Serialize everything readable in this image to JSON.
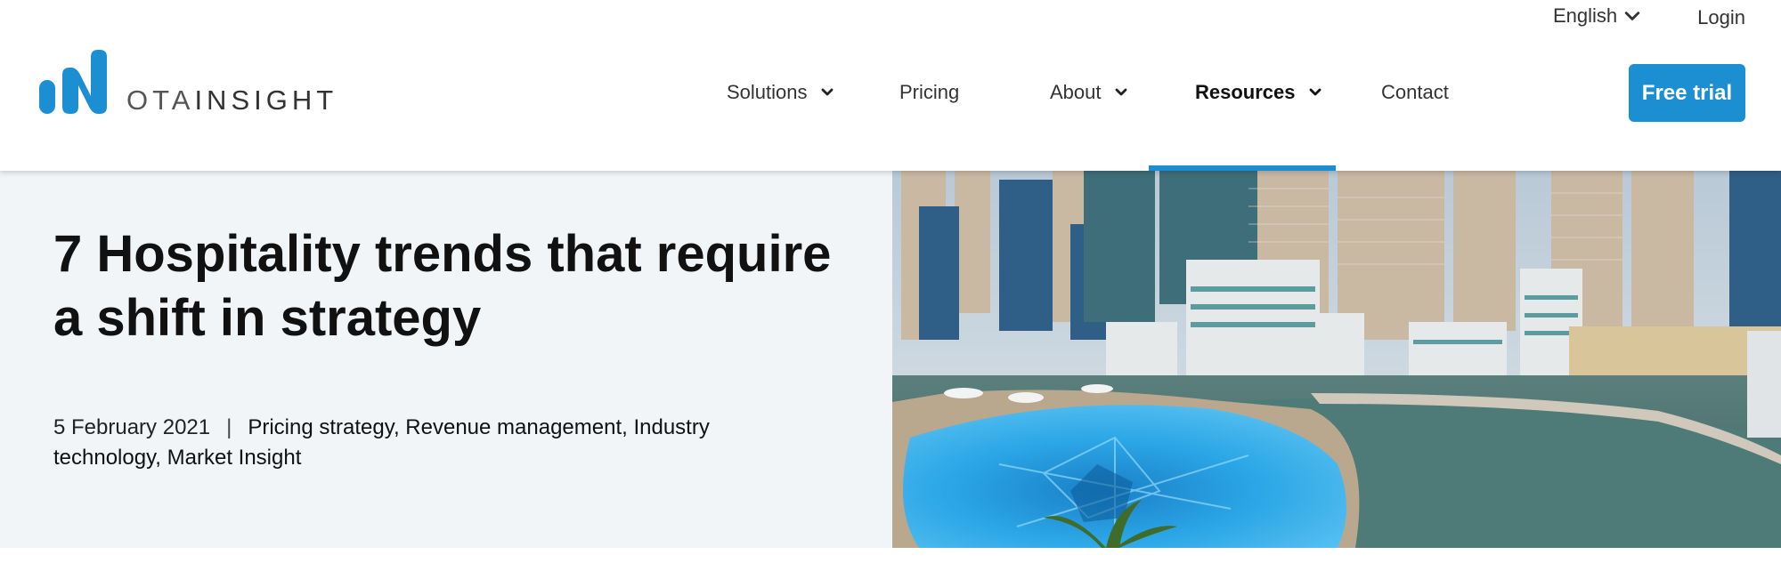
{
  "utility": {
    "language": "English",
    "login": "Login"
  },
  "brand": {
    "logo_text_ota": "OTA",
    "logo_text_insight": "INSIGHT",
    "accent_color": "#1b8fd2"
  },
  "nav": {
    "items": [
      {
        "label": "Solutions",
        "has_dropdown": true,
        "active": false
      },
      {
        "label": "Pricing",
        "has_dropdown": false,
        "active": false
      },
      {
        "label": "About",
        "has_dropdown": true,
        "active": false
      },
      {
        "label": "Resources",
        "has_dropdown": true,
        "active": true
      },
      {
        "label": "Contact",
        "has_dropdown": false,
        "active": false
      }
    ],
    "cta": "Free trial"
  },
  "article": {
    "title": "7 Hospitality trends that require a shift in strategy",
    "date": "5 February 2021",
    "separator": "|",
    "categories": "Pricing strategy, Revenue management, Industry technology, Market Insight"
  },
  "icons": {
    "dropdown": "chevron-down-icon",
    "logo": "ota-insight-logo-icon"
  }
}
